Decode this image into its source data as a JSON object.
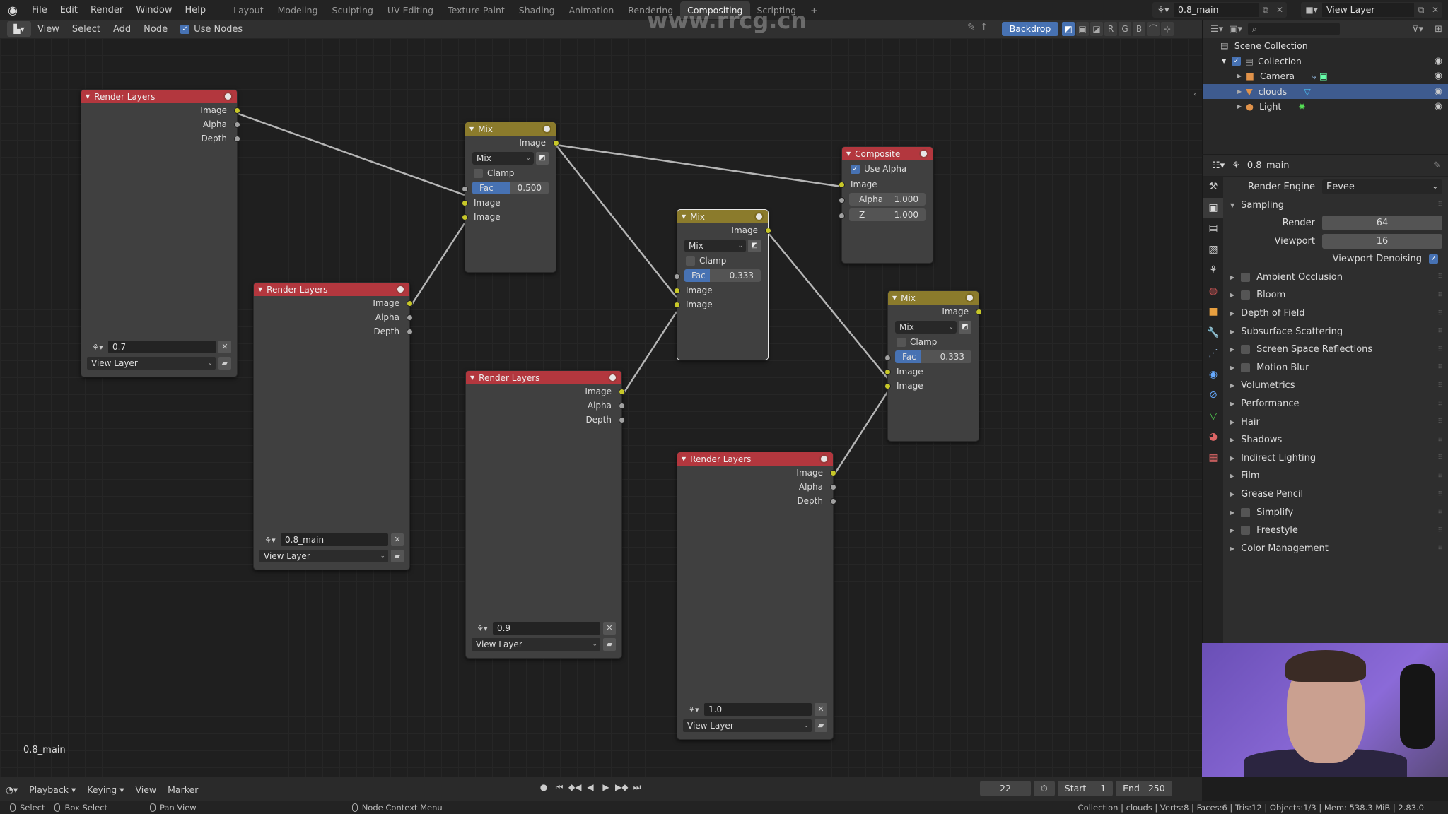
{
  "topbar": {
    "menu": [
      "File",
      "Edit",
      "Render",
      "Window",
      "Help"
    ],
    "workspaces": [
      "Layout",
      "Modeling",
      "Sculpting",
      "UV Editing",
      "Texture Paint",
      "Shading",
      "Animation",
      "Rendering",
      "Compositing",
      "Scripting"
    ],
    "active_workspace": "Compositing",
    "add_workspace": "+",
    "scene": "0.8_main",
    "view_layer": "View Layer"
  },
  "node_header": {
    "menu": [
      "View",
      "Select",
      "Add",
      "Node"
    ],
    "use_nodes_label": "Use Nodes",
    "use_nodes_checked": true,
    "backdrop_label": "Backdrop",
    "channels": [
      "R",
      "G",
      "B"
    ]
  },
  "nodes": {
    "rl1": {
      "title": "Render Layers",
      "outputs": [
        "Image",
        "Alpha",
        "Depth"
      ],
      "scene": "0.7",
      "layer": "View Layer"
    },
    "rl2": {
      "title": "Render Layers",
      "outputs": [
        "Image",
        "Alpha",
        "Depth"
      ],
      "scene": "0.8_main",
      "layer": "View Layer"
    },
    "rl3": {
      "title": "Render Layers",
      "outputs": [
        "Image",
        "Alpha",
        "Depth"
      ],
      "scene": "0.9",
      "layer": "View Layer"
    },
    "rl4": {
      "title": "Render Layers",
      "outputs": [
        "Image",
        "Alpha",
        "Depth"
      ],
      "scene": "1.0",
      "layer": "View Layer"
    },
    "mix1": {
      "title": "Mix",
      "output": "Image",
      "blend": "Mix",
      "clamp_label": "Clamp",
      "fac_label": "Fac",
      "fac": "0.500",
      "fac_fraction": 0.5,
      "inputs": [
        "Image",
        "Image"
      ]
    },
    "mix2": {
      "title": "Mix",
      "output": "Image",
      "blend": "Mix",
      "clamp_label": "Clamp",
      "fac_label": "Fac",
      "fac": "0.333",
      "fac_fraction": 0.333,
      "inputs": [
        "Image",
        "Image"
      ]
    },
    "mix3": {
      "title": "Mix",
      "output": "Image",
      "blend": "Mix",
      "clamp_label": "Clamp",
      "fac_label": "Fac",
      "fac": "0.333",
      "fac_fraction": 0.333,
      "inputs": [
        "Image",
        "Image"
      ]
    },
    "composite": {
      "title": "Composite",
      "use_alpha_label": "Use Alpha",
      "use_alpha": true,
      "input": "Image",
      "alpha_label": "Alpha",
      "alpha": "1.000",
      "z_label": "Z",
      "z": "1.000"
    }
  },
  "canvas": {
    "scene_label": "0.8_main"
  },
  "outliner": {
    "root": "Scene Collection",
    "collection": "Collection",
    "items": [
      {
        "name": "Camera",
        "selected": false
      },
      {
        "name": "clouds",
        "selected": true
      },
      {
        "name": "Light",
        "selected": false
      }
    ]
  },
  "properties": {
    "scene": "0.8_main",
    "render_engine_label": "Render Engine",
    "render_engine": "Eevee",
    "sampling_label": "Sampling",
    "render_label": "Render",
    "render_samples": "64",
    "viewport_label": "Viewport",
    "viewport_samples": "16",
    "viewport_denoising_label": "Viewport Denoising",
    "viewport_denoising": true,
    "panels": [
      {
        "label": "Ambient Occlusion",
        "checkbox": true
      },
      {
        "label": "Bloom",
        "checkbox": true
      },
      {
        "label": "Depth of Field",
        "checkbox": false
      },
      {
        "label": "Subsurface Scattering",
        "checkbox": false
      },
      {
        "label": "Screen Space Reflections",
        "checkbox": true
      },
      {
        "label": "Motion Blur",
        "checkbox": true
      },
      {
        "label": "Volumetrics",
        "checkbox": false
      },
      {
        "label": "Performance",
        "checkbox": false
      },
      {
        "label": "Hair",
        "checkbox": false
      },
      {
        "label": "Shadows",
        "checkbox": false
      },
      {
        "label": "Indirect Lighting",
        "checkbox": false
      },
      {
        "label": "Film",
        "checkbox": false
      },
      {
        "label": "Grease Pencil",
        "checkbox": false
      },
      {
        "label": "Simplify",
        "checkbox": true
      },
      {
        "label": "Freestyle",
        "checkbox": true
      },
      {
        "label": "Color Management",
        "checkbox": false
      }
    ]
  },
  "timeline": {
    "menu": [
      "Playback",
      "Keying",
      "View",
      "Marker"
    ],
    "current_frame": "22",
    "start_label": "Start",
    "start": "1",
    "end_label": "End",
    "end": "250"
  },
  "statusbar": {
    "select": "Select",
    "box_select": "Box Select",
    "pan_view": "Pan View",
    "context_menu": "Node Context Menu",
    "stats": "Collection | clouds | Verts:8 | Faces:6 | Tris:12 | Objects:1/3 | Mem: 538.3 MiB | 2.83.0"
  },
  "watermark": "www.rrcg.cn"
}
